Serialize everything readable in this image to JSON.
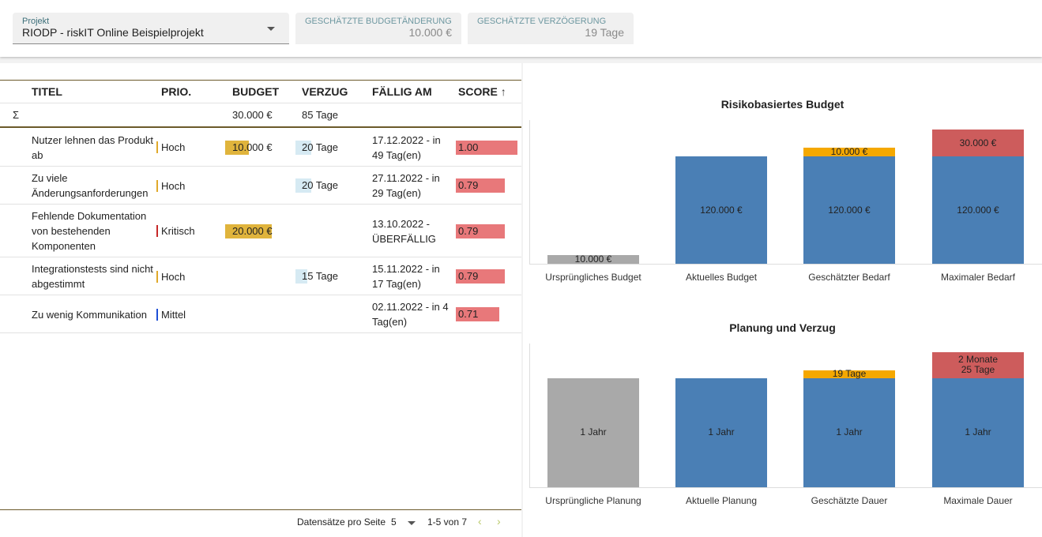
{
  "topbar": {
    "project_label": "Projekt",
    "project_value": "RIODP - riskIT Online Beispielprojekt",
    "budget_label": "GESCHÄTZTE BUDGETÄNDERUNG",
    "budget_value": "10.000 €",
    "delay_label": "GESCHÄTZTE VERZÖGERUNG",
    "delay_value": "19 Tage"
  },
  "table": {
    "headers": {
      "title": "TITEL",
      "prio": "PRIO.",
      "budget": "BUDGET",
      "delay": "VERZUG",
      "due": "FÄLLIG AM",
      "score": "SCORE"
    },
    "sum": {
      "symbol": "Σ",
      "budget": "30.000 €",
      "delay": "85 Tage"
    },
    "rows": [
      {
        "title": "Nutzer lehnen das Produkt ab",
        "prio": "Hoch",
        "prio_color": "#e0a92a",
        "budget": "10.000 €",
        "budget_fraction": 0.5,
        "delay": "20 Tage",
        "delay_fraction": 1.0,
        "due": "17.12.2022 - in 49 Tag(en)",
        "score": "1.00",
        "score_value": 1.0
      },
      {
        "title": "Zu viele Änderungsanforderungen",
        "prio": "Hoch",
        "prio_color": "#e0a92a",
        "budget": "",
        "budget_fraction": 0,
        "delay": "20 Tage",
        "delay_fraction": 1.0,
        "due": "27.11.2022 - in 29 Tag(en)",
        "score": "0.79",
        "score_value": 0.79
      },
      {
        "title": "Fehlende Dokumentation von bestehenden Komponenten",
        "prio": "Kritisch",
        "prio_color": "#c62828",
        "budget": "20.000 €",
        "budget_fraction": 1.0,
        "delay": "",
        "delay_fraction": 0,
        "due": "13.10.2022 - ÜBERFÄLLIG",
        "score": "0.79",
        "score_value": 0.79
      },
      {
        "title": "Integrationstests sind nicht abgestimmt",
        "prio": "Hoch",
        "prio_color": "#e0a92a",
        "budget": "",
        "budget_fraction": 0,
        "delay": "15 Tage",
        "delay_fraction": 0.75,
        "due": "15.11.2022 - in 17 Tag(en)",
        "score": "0.79",
        "score_value": 0.79
      },
      {
        "title": "Zu wenig Kommunikation",
        "prio": "Mittel",
        "prio_color": "#1e4fd6",
        "budget": "",
        "budget_fraction": 0,
        "delay": "",
        "delay_fraction": 0,
        "due": "02.11.2022 - in 4 Tag(en)",
        "score": "0.71",
        "score_value": 0.71
      }
    ]
  },
  "pager": {
    "label": "Datensätze pro Seite",
    "per_page": "5",
    "range": "1-5 von 7",
    "prev": "‹",
    "next": "›"
  },
  "colors": {
    "base_grey": "#a9a9a9",
    "base_blue": "#4a7fb5",
    "estimated_orange": "#f5a800",
    "max_red": "#cd5c5c",
    "budget_bar": "#e0b43c",
    "delay_bar": "#d6eaf3",
    "score_bar": "#e8787a"
  },
  "chart_data": [
    {
      "type": "bar",
      "title": "Risikobasiertes Budget",
      "categories": [
        "Ursprüngliches Budget",
        "Aktuelles Budget",
        "Geschätzter Bedarf",
        "Maximaler Bedarf"
      ],
      "unit": "€",
      "ylim": [
        0,
        150000
      ],
      "segments": [
        [
          {
            "value": 10000,
            "label": "10.000 €",
            "color": "#a9a9a9"
          }
        ],
        [
          {
            "value": 120000,
            "label": "120.000 €",
            "color": "#4a7fb5"
          }
        ],
        [
          {
            "value": 120000,
            "label": "120.000 €",
            "color": "#4a7fb5"
          },
          {
            "value": 10000,
            "label": "10.000 €",
            "color": "#f5a800"
          }
        ],
        [
          {
            "value": 120000,
            "label": "120.000 €",
            "color": "#4a7fb5"
          },
          {
            "value": 30000,
            "label": "30.000 €",
            "color": "#cd5c5c"
          }
        ]
      ]
    },
    {
      "type": "bar",
      "title": "Planung und Verzug",
      "categories": [
        "Ursprüngliche Planung",
        "Aktuelle Planung",
        "Geschätzte Dauer",
        "Maximale Dauer"
      ],
      "unit": "Tage",
      "ylim": [
        0,
        480
      ],
      "segments": [
        [
          {
            "value": 365,
            "label": "1 Jahr",
            "color": "#a9a9a9"
          }
        ],
        [
          {
            "value": 365,
            "label": "1 Jahr",
            "color": "#4a7fb5"
          }
        ],
        [
          {
            "value": 365,
            "label": "1 Jahr",
            "color": "#4a7fb5"
          },
          {
            "value": 19,
            "label": "19 Tage",
            "color": "#f5a800"
          }
        ],
        [
          {
            "value": 365,
            "label": "1 Jahr",
            "color": "#4a7fb5"
          },
          {
            "value": 85,
            "label": "2 Monate 25 Tage",
            "color": "#cd5c5c"
          }
        ]
      ]
    }
  ]
}
